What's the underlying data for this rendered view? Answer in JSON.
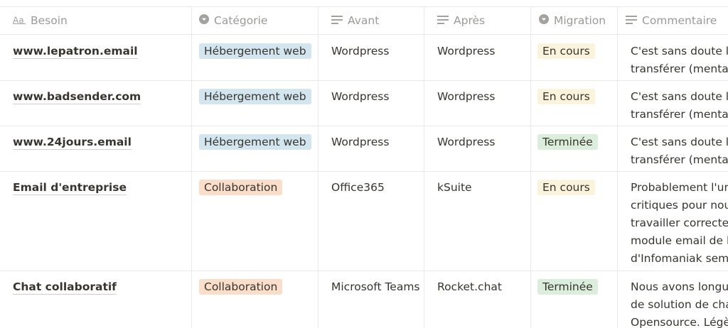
{
  "columns": [
    {
      "label": "Besoin",
      "icon": "title-icon"
    },
    {
      "label": "Catégorie",
      "icon": "select-icon"
    },
    {
      "label": "Avant",
      "icon": "text-icon"
    },
    {
      "label": "Après",
      "icon": "text-icon"
    },
    {
      "label": "Migration",
      "icon": "select-icon"
    },
    {
      "label": "Commentaire",
      "icon": "text-icon"
    }
  ],
  "colors": {
    "tag_blue": "#d3e5ef",
    "tag_orange": "#fadec9",
    "tag_yellow": "#fbf3db",
    "tag_green": "#dbeddb"
  },
  "rows": [
    {
      "besoin": "www.lepatron.email",
      "categorie": "Hébergement web",
      "avant": "Wordpress",
      "apres": "Wordpress",
      "migration": "En cours",
      "commentaire_lines": [
        "C'est sans doute le p",
        "transférer (mentaler"
      ]
    },
    {
      "besoin": "www.badsender.com",
      "categorie": "Hébergement web",
      "avant": "Wordpress",
      "apres": "Wordpress",
      "migration": "En cours",
      "commentaire_lines": [
        "C'est sans doute le p",
        "transférer (mentaler"
      ]
    },
    {
      "besoin": "www.24jours.email",
      "categorie": "Hébergement web",
      "avant": "Wordpress",
      "apres": "Wordpress",
      "migration": "Terminée",
      "commentaire_lines": [
        "C'est sans doute le p",
        "transférer (mentaler"
      ]
    },
    {
      "besoin": "Email d'entreprise",
      "categorie": "Collaboration",
      "avant": "Office365",
      "apres": "kSuite",
      "migration": "En cours",
      "commentaire_lines": [
        "Probablement l'une",
        "critiques pour nous",
        "travailler correcteme",
        "module email de la",
        "d'Infomaniak sembl"
      ]
    },
    {
      "besoin": "Chat collaboratif",
      "categorie": "Collaboration",
      "avant": "Microsoft Teams",
      "apres": "Rocket.chat",
      "migration": "Terminée",
      "commentaire_lines": [
        "Nous avons longuer",
        "de solution de chat",
        "Opensource. Légère"
      ]
    }
  ]
}
